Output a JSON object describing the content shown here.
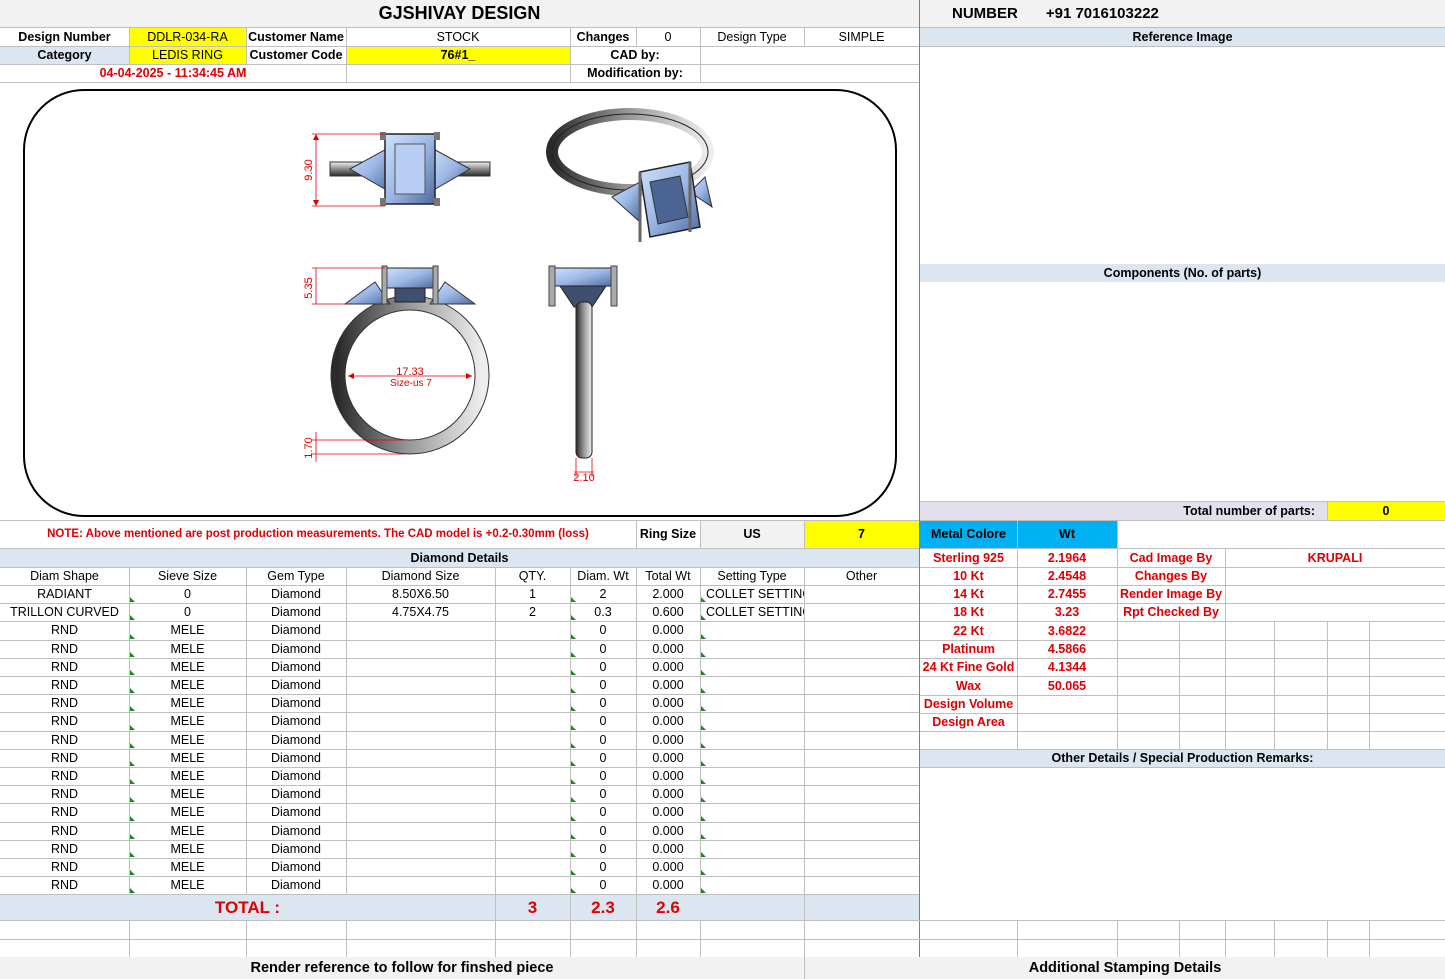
{
  "header": {
    "company": "GJSHIVAY DESIGN",
    "number_label": "NUMBER",
    "number_value": "+91 7016103222"
  },
  "info": {
    "design_number_label": "Design Number",
    "design_number": "DDLR-034-RA",
    "customer_name_label": "Customer Name",
    "customer_name": "STOCK",
    "changes_label": "Changes",
    "changes": "0",
    "design_type_label": "Design Type",
    "design_type": "SIMPLE",
    "category_label": "Category",
    "category": "LEDIS RING",
    "customer_code_label": "Customer Code",
    "customer_code": "76#1_",
    "cad_by_label": "CAD by:",
    "timestamp": "04-04-2025 - 11:34:45 AM",
    "modification_by_label": "Modification by:"
  },
  "drawing": {
    "dim_top_height": "9.30",
    "dim_head_height": "5.35",
    "dim_inner_diameter": "17.33",
    "dim_size_label": "Size-us 7",
    "dim_shank_height": "1.70",
    "dim_shank_width": "2.10"
  },
  "right_panel": {
    "reference_image": "Reference Image",
    "components": "Components (No. of parts)",
    "total_parts_label": "Total number of parts:",
    "total_parts": "0",
    "metal_colore": "Metal Colore",
    "wt": "Wt",
    "metals": [
      {
        "name": "Sterling 925",
        "wt": "2.1964"
      },
      {
        "name": "10 Kt",
        "wt": "2.4548"
      },
      {
        "name": "14 Kt",
        "wt": "2.7455"
      },
      {
        "name": "18 Kt",
        "wt": "3.23"
      },
      {
        "name": "22 Kt",
        "wt": "3.6822"
      },
      {
        "name": "Platinum",
        "wt": "4.5866"
      },
      {
        "name": "24 Kt Fine Gold",
        "wt": "4.1344"
      },
      {
        "name": "Wax",
        "wt": "50.065"
      },
      {
        "name": "Design Volume",
        "wt": ""
      },
      {
        "name": "Design Area",
        "wt": ""
      }
    ],
    "cad_image_by_label": "Cad Image By",
    "cad_image_by": "KRUPALI",
    "changes_by_label": "Changes By",
    "render_image_by_label": "Render Image By",
    "rpt_checked_by_label": "Rpt Checked By",
    "other_details": "Other Details / Special Production Remarks:"
  },
  "note": {
    "text": "NOTE: Above mentioned are post production measurements. The CAD model is +0.2-0.30mm (loss)",
    "ring_size_label": "Ring Size",
    "ring_size_unit": "US",
    "ring_size": "7"
  },
  "diamond": {
    "title": "Diamond Details",
    "headers": [
      "Diam Shape",
      "Sieve Size",
      "Gem Type",
      "Diamond Size",
      "QTY.",
      "Diam. Wt",
      "Total Wt",
      "Setting Type",
      "Other"
    ],
    "rows": [
      [
        "RADIANT",
        "0",
        "Diamond",
        "8.50X6.50",
        "1",
        "2",
        "2.000",
        "COLLET SETTING",
        ""
      ],
      [
        "TRILLON CURVED",
        "0",
        "Diamond",
        "4.75X4.75",
        "2",
        "0.3",
        "0.600",
        "COLLET SETTING",
        ""
      ],
      [
        "RND",
        "MELE",
        "Diamond",
        "",
        "",
        "0",
        "0.000",
        "",
        ""
      ],
      [
        "RND",
        "MELE",
        "Diamond",
        "",
        "",
        "0",
        "0.000",
        "",
        ""
      ],
      [
        "RND",
        "MELE",
        "Diamond",
        "",
        "",
        "0",
        "0.000",
        "",
        ""
      ],
      [
        "RND",
        "MELE",
        "Diamond",
        "",
        "",
        "0",
        "0.000",
        "",
        ""
      ],
      [
        "RND",
        "MELE",
        "Diamond",
        "",
        "",
        "0",
        "0.000",
        "",
        ""
      ],
      [
        "RND",
        "MELE",
        "Diamond",
        "",
        "",
        "0",
        "0.000",
        "",
        ""
      ],
      [
        "RND",
        "MELE",
        "Diamond",
        "",
        "",
        "0",
        "0.000",
        "",
        ""
      ],
      [
        "RND",
        "MELE",
        "Diamond",
        "",
        "",
        "0",
        "0.000",
        "",
        ""
      ],
      [
        "RND",
        "MELE",
        "Diamond",
        "",
        "",
        "0",
        "0.000",
        "",
        ""
      ],
      [
        "RND",
        "MELE",
        "Diamond",
        "",
        "",
        "0",
        "0.000",
        "",
        ""
      ],
      [
        "RND",
        "MELE",
        "Diamond",
        "",
        "",
        "0",
        "0.000",
        "",
        ""
      ],
      [
        "RND",
        "MELE",
        "Diamond",
        "",
        "",
        "0",
        "0.000",
        "",
        ""
      ],
      [
        "RND",
        "MELE",
        "Diamond",
        "",
        "",
        "0",
        "0.000",
        "",
        ""
      ],
      [
        "RND",
        "MELE",
        "Diamond",
        "",
        "",
        "0",
        "0.000",
        "",
        ""
      ],
      [
        "RND",
        "MELE",
        "Diamond",
        "",
        "",
        "0",
        "0.000",
        "",
        ""
      ]
    ],
    "total_label": "TOTAL :",
    "total_qty": "3",
    "total_diam_wt": "2.3",
    "total_wt": "2.6"
  },
  "footer": {
    "render_reference": "Render reference to follow for finshed piece",
    "additional_stamping": "Additional Stamping Details"
  },
  "colors": {
    "yellow": "#ffff00",
    "light_blue": "#dce6f1",
    "cyan": "#00b0f0",
    "red_text": "#e00000",
    "gem": "#a9c3ec"
  }
}
